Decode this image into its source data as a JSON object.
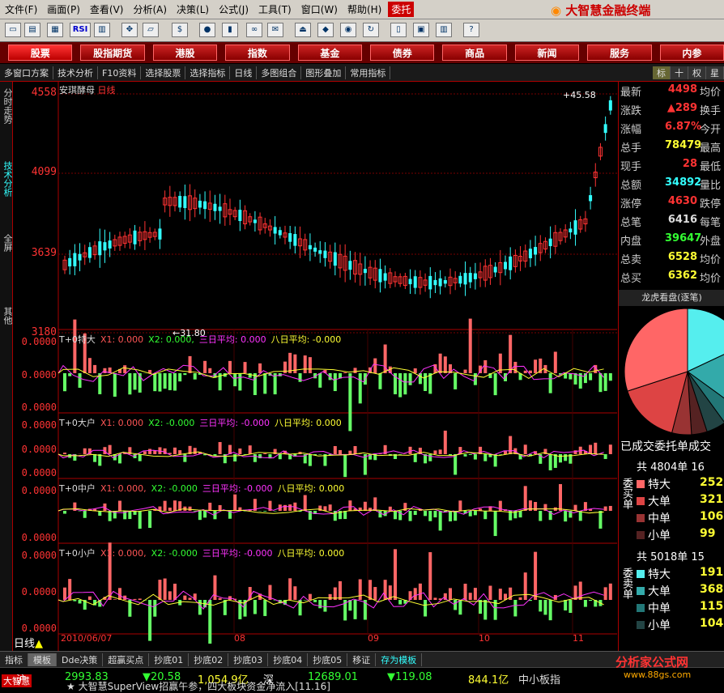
{
  "menu": {
    "items": [
      "文件(F)",
      "画面(P)",
      "查看(V)",
      "分析(A)",
      "决策(L)",
      "公式(J)",
      "工具(T)",
      "窗口(W)",
      "帮助(H)"
    ],
    "entrust": "委托",
    "brand": "大智慧金融终端"
  },
  "toolbar": {
    "rsi": "RSI"
  },
  "nav": {
    "items": [
      "股票",
      "股指期货",
      "港股",
      "指数",
      "基金",
      "债券",
      "商品",
      "新闻",
      "服务",
      "内参"
    ]
  },
  "subbar": {
    "items": [
      "多窗口方案",
      "技术分析",
      "F10资料",
      "选择股票",
      "选择指标",
      "日线",
      "多图组合",
      "图形叠加",
      "常用指标"
    ],
    "right": [
      "标",
      "十",
      "权",
      "星"
    ]
  },
  "sidetabs": [
    "分时走势",
    "技术分析",
    "全屏",
    "其他"
  ],
  "chart_header": {
    "name": "安琪酵母",
    "period": "日线"
  },
  "price_axis": {
    "ticks": [
      "4558",
      "4099",
      "3639",
      "3180"
    ]
  },
  "price_marks": {
    "high": "45.58",
    "low": "31.80"
  },
  "chart_data": [
    {
      "type": "candlestick",
      "title": "安琪酵母 日线",
      "ylim": [
        31.8,
        45.58
      ],
      "x_labels": [
        "2010/06/07",
        "08",
        "09",
        "10",
        "11"
      ],
      "highlights": {
        "max": 45.58,
        "min": 31.8
      }
    },
    {
      "type": "bar",
      "title": "T+0特大",
      "series": [
        {
          "name": "X1",
          "value": "0.000"
        },
        {
          "name": "X2",
          "value": "0.000"
        },
        {
          "name": "三日平均",
          "value": "0.000"
        },
        {
          "name": "八日平均",
          "value": "-0.000"
        }
      ],
      "yticks": [
        "0.0000",
        "0.0000",
        "0.0000"
      ]
    },
    {
      "type": "bar",
      "title": "T+0大户",
      "series": [
        {
          "name": "X1",
          "value": "0.000"
        },
        {
          "name": "X2",
          "value": "-0.000"
        },
        {
          "name": "三日平均",
          "value": "-0.000"
        },
        {
          "name": "八日平均",
          "value": "0.000"
        }
      ],
      "yticks": [
        "0.0000",
        "0.0000",
        "0.0000"
      ]
    },
    {
      "type": "bar",
      "title": "T+0中户",
      "series": [
        {
          "name": "X1",
          "value": "0.000"
        },
        {
          "name": "X2",
          "value": "-0.000"
        },
        {
          "name": "三日平均",
          "value": "-0.000"
        },
        {
          "name": "八日平均",
          "value": "0.000"
        }
      ],
      "yticks": [
        "0.0000",
        "0.0000"
      ]
    },
    {
      "type": "bar",
      "title": "T+0小户",
      "series": [
        {
          "name": "X1",
          "value": "0.000"
        },
        {
          "name": "X2",
          "value": "-0.000"
        },
        {
          "name": "三日平均",
          "value": "-0.000"
        },
        {
          "name": "八日平均",
          "value": "0.000"
        }
      ],
      "yticks": [
        "0.0000",
        "0.0000",
        "0.0000"
      ]
    }
  ],
  "indicators": [
    {
      "title": "T+0特大",
      "x1": "X1: 0.000",
      "x2": "X2: 0.000,",
      "a3": "三日平均: 0.000",
      "a8": "八日平均: -0.000",
      "yt": [
        "0.0000",
        "0.0000",
        "0.0000"
      ]
    },
    {
      "title": "T+0大户",
      "x1": "X1: 0.000",
      "x2": "X2: -0.000",
      "a3": "三日平均: -0.000",
      "a8": "八日平均: 0.000",
      "yt": [
        "0.0000",
        "0.0000",
        "0.0000"
      ]
    },
    {
      "title": "T+0中户",
      "x1": "X1: 0.000,",
      "x2": "X2: -0.000",
      "a3": "三日平均: -0.000",
      "a8": "八日平均: 0.000",
      "yt": [
        "0.0000",
        "0.0000"
      ]
    },
    {
      "title": "T+0小户",
      "x1": "X1: 0.000,",
      "x2": "X2: -0.000",
      "a3": "三日平均: -0.000",
      "a8": "八日平均: 0.000",
      "yt": [
        "0.0000",
        "0.0000",
        "0.0000"
      ]
    }
  ],
  "x_axis": {
    "labels": [
      "2010/06/07",
      "08",
      "09",
      "10",
      "11"
    ],
    "period": "日线"
  },
  "quote": {
    "rows": [
      {
        "k": "最新",
        "v": "4498",
        "k2": "均价",
        "c": "#ff3333"
      },
      {
        "k": "涨跌",
        "v": "▲289",
        "k2": "换手",
        "c": "#ff3333"
      },
      {
        "k": "涨幅",
        "v": "6.87%",
        "k2": "今开",
        "c": "#ff3333"
      },
      {
        "k": "总手",
        "v": "78479",
        "k2": "最高",
        "c": "#ffff33"
      },
      {
        "k": "现手",
        "v": "28",
        "k2": "最低",
        "c": "#ff3333"
      },
      {
        "k": "总额",
        "v": "34892",
        "k2": "量比",
        "c": "#33ffff"
      },
      {
        "k": "涨停",
        "v": "4630",
        "k2": "跌停",
        "c": "#ff3333"
      },
      {
        "k": "总笔",
        "v": "6416",
        "k2": "每笔",
        "c": "#dddddd"
      },
      {
        "k": "内盘",
        "v": "39647",
        "k2": "外盘",
        "c": "#33ff33"
      },
      {
        "k": "总卖",
        "v": "6528",
        "k2": "均价",
        "c": "#ffff33"
      },
      {
        "k": "总买",
        "v": "6362",
        "k2": "均价",
        "c": "#ffff33"
      }
    ]
  },
  "pie_title": "龙虎看盘(逐笔)",
  "orders": {
    "title": "已成交委托单成交",
    "buy_total": "共 4804单 16",
    "sell_total": "共 5018单 15",
    "buy_label": "委买单",
    "sell_label": "委卖单",
    "buy": [
      {
        "k": "特大",
        "v": "252",
        "c": "#ff6666"
      },
      {
        "k": "大单",
        "v": "321",
        "c": "#dd4444"
      },
      {
        "k": "中单",
        "v": "106",
        "c": "#993333"
      },
      {
        "k": "小单",
        "v": "99",
        "c": "#552222"
      }
    ],
    "sell": [
      {
        "k": "特大",
        "v": "191",
        "c": "#55eeee"
      },
      {
        "k": "大单",
        "v": "368",
        "c": "#33aaaa"
      },
      {
        "k": "中单",
        "v": "115",
        "c": "#227777"
      },
      {
        "k": "小单",
        "v": "104",
        "c": "#224444"
      }
    ]
  },
  "bottom_tabs": [
    "指标",
    "模板",
    "Dde决策",
    "超赢买点",
    "抄底01",
    "抄底02",
    "抄底03",
    "抄底04",
    "抄底05",
    "移证",
    "存为模板"
  ],
  "status": {
    "sh_label": "沪",
    "sh_index": "2993.83",
    "sh_change": "▼20.58",
    "sh_amount": "1,054.9亿",
    "sz_label": "深",
    "sz_index": "12689.01",
    "sz_change": "▼119.08",
    "sz_amount": "844.1亿",
    "board": "中小板指",
    "logo": "大智慧",
    "ticker": "大智慧SuperView招赢午参，四大板块资金净流入[11.16]",
    "watermark": "分析家公式网",
    "watermark_url": "www.88gs.com"
  }
}
